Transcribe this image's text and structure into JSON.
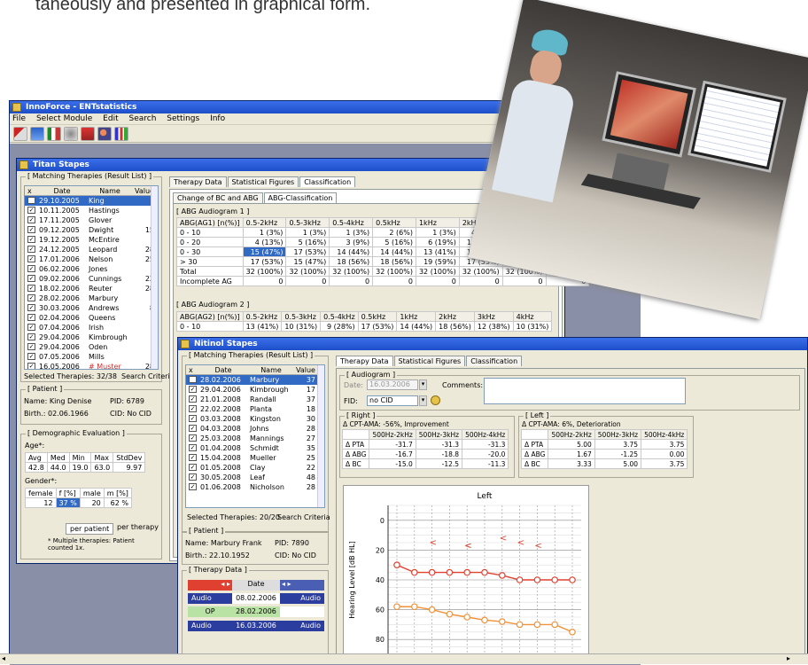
{
  "caption": "taneously and presented in graphical form.",
  "main_window": {
    "title": "InnoForce - ENTstatistics",
    "menu": [
      "File",
      "Select Module",
      "Edit",
      "Search",
      "Settings",
      "Info"
    ]
  },
  "titan": {
    "title": "Titan Stapes",
    "matching_title": "[ Matching Therapies (Result List) ]",
    "list_headers": [
      "x",
      "Date",
      "Name",
      "Value"
    ],
    "rows": [
      {
        "date": "29.10.2005",
        "name": "King",
        "value": ""
      },
      {
        "date": "10.11.2005",
        "name": "Hastings",
        "value": ""
      },
      {
        "date": "17.11.2005",
        "name": "Glover",
        "value": ""
      },
      {
        "date": "09.12.2005",
        "name": "Dwight",
        "value": "15"
      },
      {
        "date": "19.12.2005",
        "name": "McEntire",
        "value": ""
      },
      {
        "date": "24.12.2005",
        "name": "Leopard",
        "value": "28"
      },
      {
        "date": "17.01.2006",
        "name": "Nelson",
        "value": "25"
      },
      {
        "date": "06.02.2006",
        "name": "Jones",
        "value": ""
      },
      {
        "date": "09.02.2006",
        "name": "Cunnings",
        "value": "22"
      },
      {
        "date": "18.02.2006",
        "name": "Reuter",
        "value": "28"
      },
      {
        "date": "28.02.2006",
        "name": "Marbury",
        "value": ""
      },
      {
        "date": "30.03.2006",
        "name": "Andrews",
        "value": "8"
      },
      {
        "date": "02.04.2006",
        "name": "Queens",
        "value": ""
      },
      {
        "date": "07.04.2006",
        "name": "Irish",
        "value": ""
      },
      {
        "date": "29.04.2006",
        "name": "Kimbrough",
        "value": ""
      },
      {
        "date": "29.04.2006",
        "name": "Oden",
        "value": ""
      },
      {
        "date": "07.05.2006",
        "name": "Mills",
        "value": ""
      },
      {
        "date": "16.05.2006",
        "name": "# Muster",
        "value": "28"
      }
    ],
    "selected": "Selected Therapies: 32/38",
    "search_criteria": "Search Criteria",
    "patient_title": "[ Patient ]",
    "patient_name": "Name: King Denise",
    "patient_pid": "PID: 6789",
    "patient_birth": "Birth.: 02.06.1966",
    "patient_cid": "CID: No CID",
    "demo_title": "[ Demographic Evaluation ]",
    "age_label": "Age*:",
    "age_headers": [
      "Avg",
      "Med",
      "Min",
      "Max",
      "StdDev"
    ],
    "age_values": [
      "42.8",
      "44.0",
      "19.0",
      "63.0",
      "9.97"
    ],
    "gender_label": "Gender*:",
    "gender_headers": [
      "female",
      "f [%]",
      "male",
      "m [%]"
    ],
    "gender_values": [
      "12",
      "37 %",
      "20",
      "62 %"
    ],
    "per_patient": "per patient",
    "per_therapy": "per therapy",
    "footnote": "* Multiple therapies: Patient counted 1x.",
    "tabs": [
      "Therapy Data",
      "Statistical Figures",
      "Classification"
    ],
    "subtabs": [
      "Change of BC and ABG",
      "ABG-Classification"
    ],
    "abg1_title": "[ ABG Audiogram 1 ]",
    "abg1_headers": [
      "ABG(AG1) [n(%)]",
      "0.5-2kHz",
      "0.5-3kHz",
      "0.5-4kHz",
      "0.5kHz",
      "1kHz",
      "2kHz",
      "3kHz",
      "4kHz"
    ],
    "abg1_rows": [
      [
        "0 - 10",
        "1 (3%)",
        "1 (3%)",
        "1 (3%)",
        "2 (6%)",
        "1 (3%)",
        "4 (13%)",
        "4 (13%)",
        ""
      ],
      [
        "0 - 20",
        "4 (13%)",
        "5 (16%)",
        "3 (9%)",
        "5 (16%)",
        "6 (19%)",
        "11 (34%)",
        "9 (28%)",
        "8 (25%)"
      ],
      [
        "0 - 30",
        "15 (47%)",
        "17 (53%)",
        "14 (44%)",
        "14 (44%)",
        "13 (41%)",
        "15 (47%)",
        "15 (47%)",
        "15 (47%)"
      ],
      [
        "> 30",
        "17 (53%)",
        "15 (47%)",
        "18 (56%)",
        "18 (56%)",
        "19 (59%)",
        "17 (53%)",
        "17 (53%)",
        "17 (53%)"
      ],
      [
        "Total",
        "32 (100%)",
        "32 (100%)",
        "32 (100%)",
        "32 (100%)",
        "32 (100%)",
        "32 (100%)",
        "32 (100%)",
        "32 (100%)"
      ],
      [
        "Incomplete AG",
        "0",
        "0",
        "0",
        "0",
        "0",
        "0",
        "0",
        "0"
      ]
    ],
    "abg2_title": "[ ABG Audiogram 2 ]",
    "abg2_headers": [
      "ABG(AG2) [n(%)]",
      "0.5-2kHz",
      "0.5-3kHz",
      "0.5-4kHz",
      "0.5kHz",
      "1kHz",
      "2kHz",
      "3kHz",
      "4kHz"
    ],
    "abg2_rows": [
      [
        "0 - 10",
        "13 (41%)",
        "10 (31%)",
        "9 (28%)",
        "17 (53%)",
        "14 (44%)",
        "18 (56%)",
        "12 (38%)",
        "10 (31%)"
      ]
    ]
  },
  "nitinol": {
    "title": "Nitinol Stapes",
    "matching_title": "[ Matching Therapies (Result List) ]",
    "list_headers": [
      "x",
      "Date",
      "Name",
      "Value"
    ],
    "rows": [
      {
        "date": "28.02.2006",
        "name": "Marbury",
        "value": "37"
      },
      {
        "date": "29.04.2006",
        "name": "Kimbrough",
        "value": "17"
      },
      {
        "date": "21.01.2008",
        "name": "Randall",
        "value": "37"
      },
      {
        "date": "22.02.2008",
        "name": "Planta",
        "value": "18"
      },
      {
        "date": "03.03.2008",
        "name": "Kingston",
        "value": "30"
      },
      {
        "date": "04.03.2008",
        "name": "Johns",
        "value": "28"
      },
      {
        "date": "25.03.2008",
        "name": "Mannings",
        "value": "27"
      },
      {
        "date": "01.04.2008",
        "name": "Schmidt",
        "value": "35"
      },
      {
        "date": "15.04.2008",
        "name": "Mueller",
        "value": "25"
      },
      {
        "date": "01.05.2008",
        "name": "Clay",
        "value": "22"
      },
      {
        "date": "30.05.2008",
        "name": "Leaf",
        "value": "48"
      },
      {
        "date": "01.06.2008",
        "name": "Nicholson",
        "value": "28"
      }
    ],
    "selected": "Selected Therapies: 20/20",
    "search_criteria": "Search Criteria",
    "patient_title": "[ Patient ]",
    "patient_name": "Name: Marbury Frank",
    "patient_pid": "PID: 7890",
    "patient_birth": "Birth.: 22.10.1952",
    "patient_cid": "CID: No CID",
    "therapy_title": "[ Therapy Data ]",
    "therapy_header": "Date",
    "therapy_rows": [
      {
        "left": "Audio",
        "date": "08.02.2006",
        "right": "Audio"
      },
      {
        "left": "OP",
        "date": "28.02.2006",
        "right": ""
      },
      {
        "left": "Audio",
        "date": "16.03.2006",
        "right": "Audio"
      }
    ],
    "tabs": [
      "Therapy Data",
      "Statistical Figures",
      "Classification"
    ],
    "audiogram_title": "[ Audiogram ]",
    "date_label": "Date:",
    "date_value": "16.03.2006",
    "comments_label": "Comments:",
    "fid_label": "FID:",
    "fid_value": "no CID",
    "right_title": "[ Right ]",
    "right_desc": "Δ CPT-AMA: -56%, Improvement",
    "left_title": "[ Left ]",
    "left_desc": "Δ CPT-AMA: 6%, Deterioration",
    "freq_headers": [
      "500Hz-2kHz",
      "500Hz-3kHz",
      "500Hz-4kHz"
    ],
    "right_rows": [
      {
        "label": "Δ PTA",
        "v": [
          "-31.7",
          "-31.3",
          "-31.3"
        ]
      },
      {
        "label": "Δ ABG",
        "v": [
          "-16.7",
          "-18.8",
          "-20.0"
        ]
      },
      {
        "label": "Δ BC",
        "v": [
          "-15.0",
          "-12.5",
          "-11.3"
        ]
      }
    ],
    "left_rows": [
      {
        "label": "Δ PTA",
        "v": [
          "5.00",
          "3.75",
          "3.75"
        ]
      },
      {
        "label": "Δ ABG",
        "v": [
          "1.67",
          "-1.25",
          "0.00"
        ]
      },
      {
        "label": "Δ BC",
        "v": [
          "3.33",
          "5.00",
          "3.75"
        ]
      }
    ],
    "chart_title": "Left",
    "chart_ylabel": "Hearing Level [dB HL]"
  },
  "chart_data": {
    "type": "line",
    "title": "Left",
    "ylabel": "Hearing Level [dB HL]",
    "ylim": [
      -10,
      90
    ],
    "y_inverted": true,
    "yticks": [
      0,
      20,
      40,
      60,
      80
    ],
    "series": [
      {
        "values": [
          30,
          35,
          35,
          35,
          35,
          35,
          37,
          40,
          40,
          40,
          40
        ]
      },
      {
        "values": [
          58,
          58,
          60,
          63,
          65,
          67,
          68,
          70,
          70,
          70,
          75
        ]
      }
    ],
    "markers_bc": [
      15,
      17,
      17,
      12,
      15,
      17
    ]
  },
  "colors": {
    "selection": "#316ac5",
    "red_series": "#e0402f",
    "orange_series": "#f0923a",
    "title_blue": "#2456c8"
  }
}
